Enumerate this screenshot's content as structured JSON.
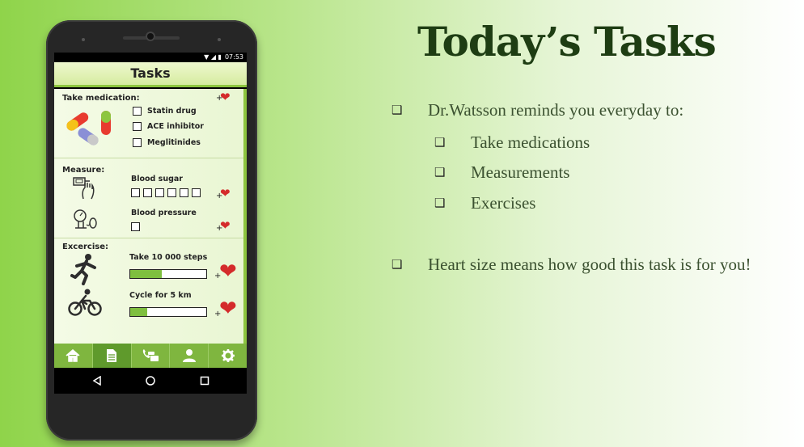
{
  "slide": {
    "title": "Today’s Tasks",
    "bullets": [
      {
        "text": "Dr.Watsson reminds you everyday to:",
        "level": 0
      },
      {
        "text": "Take medications",
        "level": 1
      },
      {
        "text": "Measurements",
        "level": 1
      },
      {
        "text": "Exercises",
        "level": 1
      },
      {
        "text": "Heart size means how good this task is for you!",
        "level": 0
      }
    ],
    "bullet_glyph": "❑"
  },
  "phone": {
    "status_time": "07:53",
    "app_title": "Tasks",
    "medication": {
      "label": "Take medication:",
      "items": [
        "Statin drug",
        "ACE inhibitor",
        "Meglitinides"
      ]
    },
    "measure": {
      "label": "Measure:",
      "blood_sugar": "Blood sugar",
      "blood_pressure": "Blood pressure"
    },
    "exercise": {
      "label": "Excercise:",
      "steps_label": "Take 10 000 steps",
      "steps_progress": 0.42,
      "cycle_label": "Cycle for 5 km",
      "cycle_progress": 0.22
    },
    "plus": "+",
    "tabs": [
      "home-icon",
      "tasks-icon",
      "contacts-icon",
      "profile-icon",
      "settings-icon"
    ],
    "active_tab": 1,
    "nav": [
      "back-icon",
      "home-circle-icon",
      "recents-icon"
    ]
  },
  "colors": {
    "title": "#1e3d13",
    "accent_green": "#8dc63f",
    "heart_red": "#d42b2b"
  }
}
